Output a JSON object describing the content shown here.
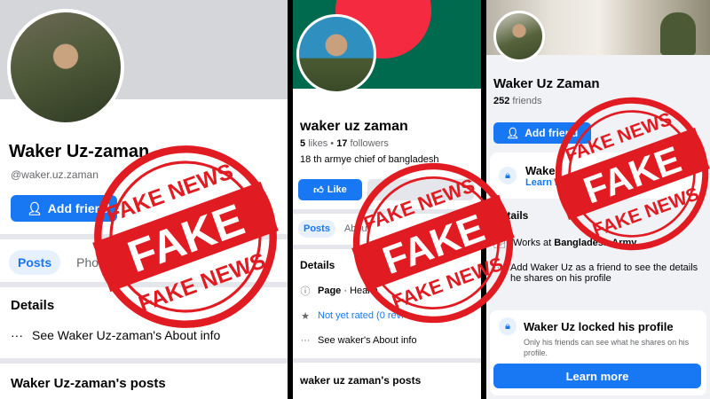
{
  "panel1": {
    "name": "Waker Uz-zaman",
    "handle": "@waker.uz.zaman",
    "add_friend_label": "Add friend",
    "tabs": [
      "Posts",
      "Photo"
    ],
    "details_heading": "Details",
    "about_text": "See Waker Uz-zaman's About info",
    "posts_heading": "Waker Uz-zaman's posts"
  },
  "panel2": {
    "name": "waker uz zaman",
    "likes_count": "5",
    "likes_label": "likes",
    "followers_count": "17",
    "followers_label": "followers",
    "bio": "18 th armye chief of bangladesh",
    "like_label": "Like",
    "tabs": [
      "Posts",
      "About"
    ],
    "details_heading": "Details",
    "page_label": "Page",
    "page_category": "· Health",
    "rating_text": "Not yet rated (0 revi",
    "about_text": "See waker's About info",
    "posts_heading": "waker uz zaman's posts"
  },
  "panel3": {
    "name": "Waker Uz Zaman",
    "friends_count": "252",
    "friends_label": "friends",
    "add_friend_label": "Add friend",
    "lock1_title": "Waker",
    "lock1_link": "Learn m",
    "details_heading": "Details",
    "works_at_prefix": "Works at",
    "works_at_org": "Bangladesh Army",
    "add_info": "Add Waker Uz as a friend to see the details he shares on his profile",
    "lock2_title": "Waker Uz locked his profile",
    "lock2_desc": "Only his friends can see what he shares on his profile.",
    "learn_more_label": "Learn more"
  },
  "stamp": {
    "top_text": "FAKE NEWS",
    "main_text": "FAKE",
    "bottom_text": "FAKE NEWS",
    "color": "#e11b22"
  },
  "colors": {
    "facebook_blue": "#1877f2",
    "flag_green": "#006a4e",
    "flag_red": "#f42a41"
  },
  "icons": [
    "add-friend-icon",
    "like-icon",
    "info-icon",
    "star-icon",
    "ellipsis-icon",
    "briefcase-icon",
    "lock-shield-icon"
  ]
}
